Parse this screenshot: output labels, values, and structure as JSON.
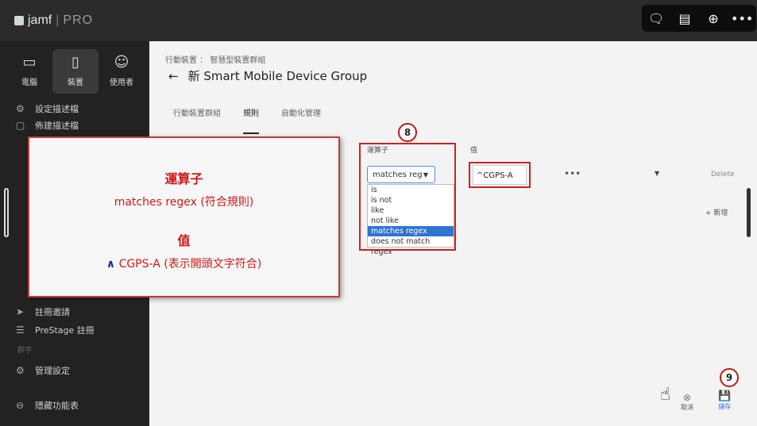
{
  "app": {
    "logo_name": "jamf",
    "logo_product": "PRO"
  },
  "top_actions": [
    "chat-icon",
    "desktop-icon",
    "download-icon",
    "more-icon"
  ],
  "sidebar": {
    "tabs": [
      {
        "label": "電腦",
        "icon": "laptop-icon"
      },
      {
        "label": "裝置",
        "icon": "mobile-device-icon"
      },
      {
        "label": "使用者",
        "icon": "user-icon"
      }
    ],
    "items": [
      {
        "label": "設定描述檔",
        "icon": "gear-doc-icon"
      },
      {
        "label": "佈建描述檔",
        "icon": "doc-icon"
      },
      {
        "label": "註冊邀請",
        "icon": "send-icon"
      },
      {
        "label": "PreStage 註冊",
        "icon": "list-icon"
      },
      {
        "label": "管理設定",
        "icon": "gear-icon"
      },
      {
        "label": "隱藏功能表",
        "icon": "collapse-icon"
      }
    ],
    "section_label": "群字"
  },
  "main": {
    "breadcrumb": "行動裝置 ： 智慧型裝置群組",
    "title": "新 Smart Mobile Device Group",
    "tabs": [
      "行動裝置群組",
      "規則",
      "自動化管理"
    ],
    "operator_label": "運算子",
    "value_label": "值",
    "operator_selected": "matches reg",
    "operator_options": [
      "is",
      "is not",
      "like",
      "not like",
      "matches regex",
      "does not match regex"
    ],
    "operator_selected_option": "matches regex",
    "value": "^CGPS-A",
    "more": "•••",
    "delete": "Delete",
    "add": "+ 新增",
    "cancel": "取消",
    "save": "儲存"
  },
  "callout": {
    "heading1": "運算子",
    "line1": "matches regex (符合規則)",
    "heading2": "值",
    "line2_symbol": "∧",
    "line2_text": " CGPS-A (表示開頭文字符合)"
  },
  "steps": [
    "8",
    "9"
  ],
  "colors": {
    "accent": "#2f74d0",
    "annotation_red": "#d01818",
    "sidebar": "#222222"
  }
}
